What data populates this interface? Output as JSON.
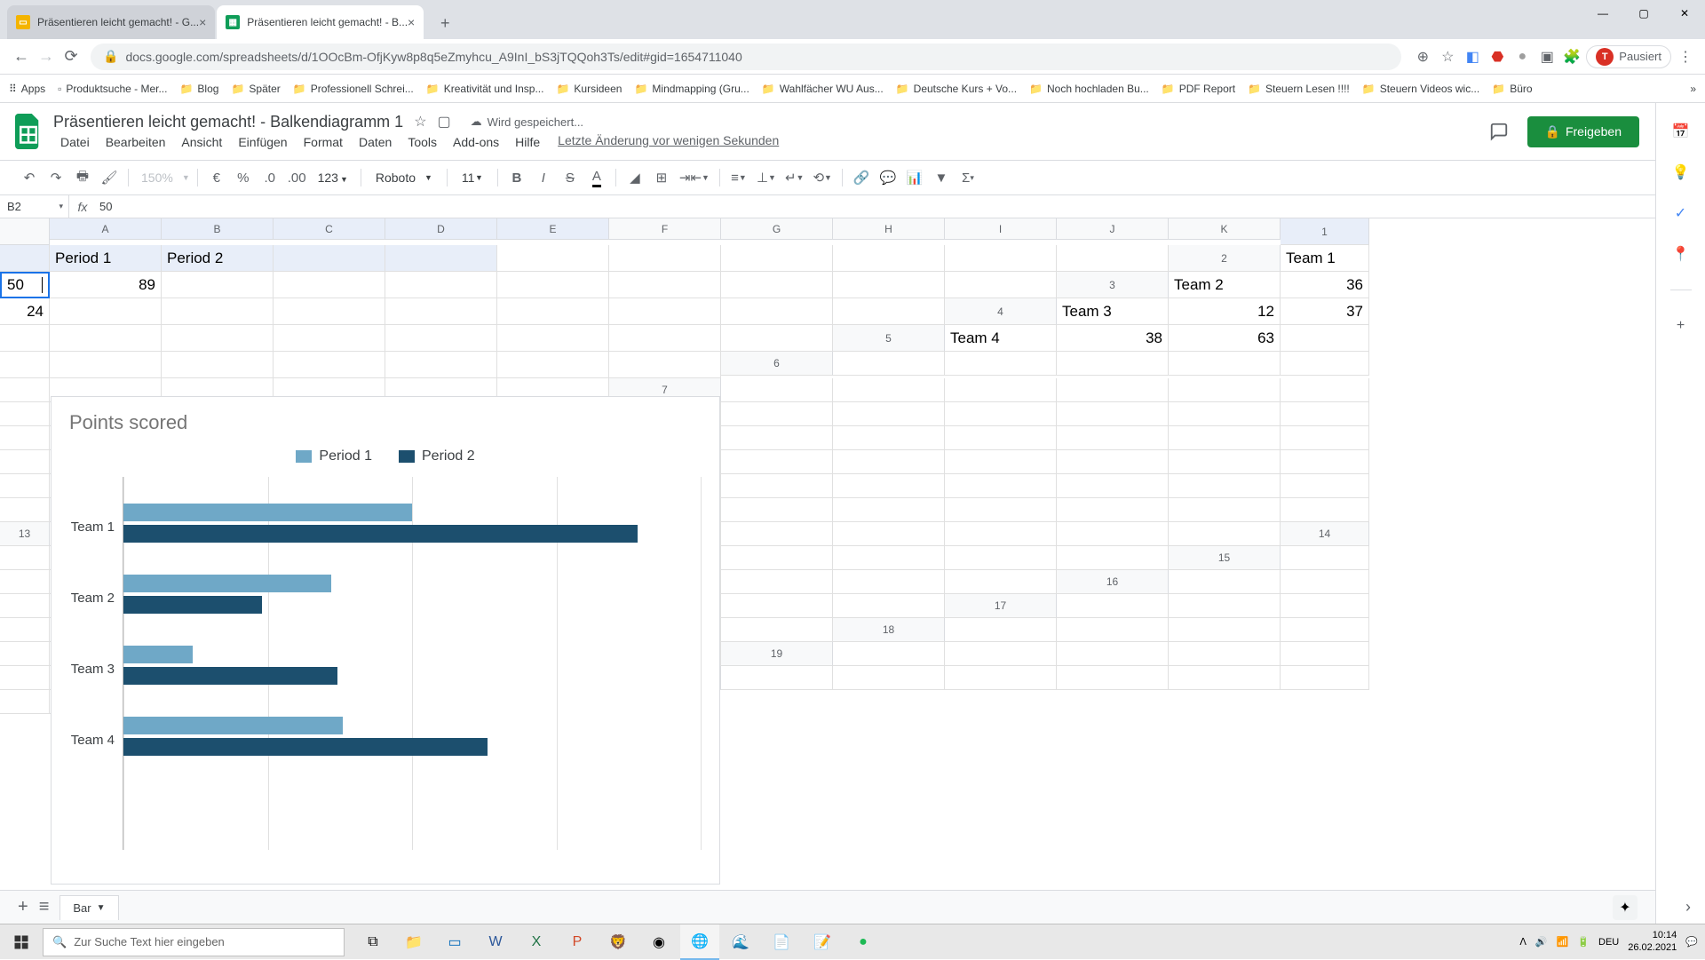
{
  "browser": {
    "tabs": [
      {
        "title": "Präsentieren leicht gemacht! - G...",
        "icon_color": "#f4b400",
        "icon_letter": "",
        "active": false
      },
      {
        "title": "Präsentieren leicht gemacht! - B...",
        "icon_color": "#0f9d58",
        "icon_letter": "",
        "active": true
      }
    ],
    "url": "docs.google.com/spreadsheets/d/1OOcBm-OfjKyw8p8q5eZmyhcu_A9InI_bS3jTQQoh3Ts/edit#gid=1654711040",
    "pause_label": "Pausiert"
  },
  "bookmarks": [
    "Apps",
    "Produktsuche - Mer...",
    "Blog",
    "Später",
    "Professionell Schrei...",
    "Kreativität und Insp...",
    "Kursideen",
    "Mindmapping  (Gru...",
    "Wahlfächer WU Aus...",
    "Deutsche Kurs + Vo...",
    "Noch hochladen Bu...",
    "PDF Report",
    "Steuern Lesen !!!!",
    "Steuern Videos wic...",
    "Büro"
  ],
  "doc": {
    "title": "Präsentieren leicht gemacht! - Balkendiagramm 1",
    "saving": "Wird gespeichert...",
    "last_edit": "Letzte Änderung vor wenigen Sekunden",
    "share": "Freigeben"
  },
  "menus": [
    "Datei",
    "Bearbeiten",
    "Ansicht",
    "Einfügen",
    "Format",
    "Daten",
    "Tools",
    "Add-ons",
    "Hilfe"
  ],
  "toolbar": {
    "zoom": "150%",
    "font": "Roboto",
    "size": "11",
    "fmt": "123"
  },
  "formula": {
    "cell": "B2",
    "value": "50"
  },
  "columns": [
    "A",
    "B",
    "C",
    "D",
    "E",
    "F",
    "G",
    "H",
    "I",
    "J",
    "K"
  ],
  "sheet": {
    "header_row": [
      "",
      "Period 1",
      "Period 2"
    ],
    "rows": [
      {
        "label": "Team 1",
        "p1": "50",
        "p2": "89"
      },
      {
        "label": "Team 2",
        "p1": "36",
        "p2": "24"
      },
      {
        "label": "Team 3",
        "p1": "12",
        "p2": "37"
      },
      {
        "label": "Team 4",
        "p1": "38",
        "p2": "63"
      }
    ]
  },
  "chart_data": {
    "type": "bar",
    "title": "Points scored",
    "categories": [
      "Team 1",
      "Team 2",
      "Team 3",
      "Team 4"
    ],
    "series": [
      {
        "name": "Period 1",
        "color": "#6fa8c7",
        "values": [
          50,
          36,
          12,
          38
        ]
      },
      {
        "name": "Period 2",
        "color": "#1c4f6e",
        "values": [
          89,
          24,
          37,
          63
        ]
      }
    ],
    "xlim": [
      0,
      100
    ],
    "gridlines": [
      0,
      25,
      50,
      75,
      100
    ]
  },
  "sheet_tab": "Bar",
  "taskbar": {
    "search_placeholder": "Zur Suche Text hier eingeben",
    "lang": "DEU",
    "time": "10:14",
    "date": "26.02.2021"
  }
}
